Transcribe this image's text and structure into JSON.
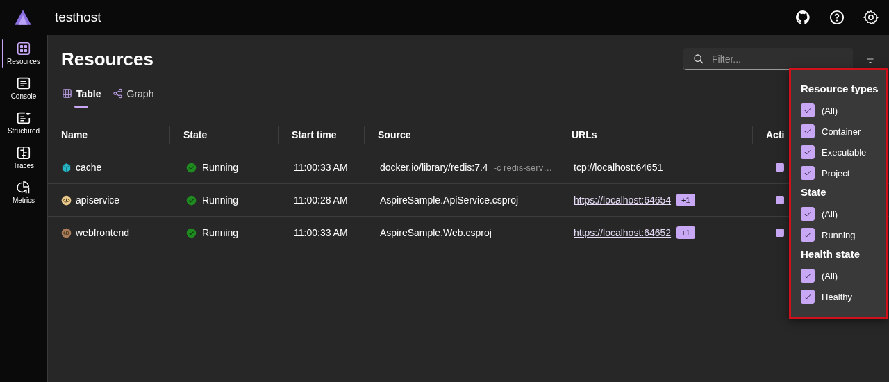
{
  "app": {
    "title": "testhost"
  },
  "header_icons": [
    {
      "kind": "github"
    },
    {
      "kind": "help"
    },
    {
      "kind": "settings"
    }
  ],
  "nav": [
    {
      "label": "Resources",
      "kind": "resources",
      "selected": true
    },
    {
      "label": "Console",
      "kind": "console",
      "selected": false
    },
    {
      "label": "Structured",
      "kind": "structured",
      "selected": false
    },
    {
      "label": "Traces",
      "kind": "traces",
      "selected": false
    },
    {
      "label": "Metrics",
      "kind": "metrics",
      "selected": false
    }
  ],
  "page": {
    "title": "Resources",
    "filter": {
      "placeholder": "Filter..."
    }
  },
  "view_tabs": [
    {
      "label": "Table",
      "kind": "table",
      "selected": true
    },
    {
      "label": "Graph",
      "kind": "graph",
      "selected": false
    }
  ],
  "table": {
    "columns": [
      "Name",
      "State",
      "Start time",
      "Source",
      "URLs",
      "Acti"
    ],
    "rows": [
      {
        "name": "cache",
        "kind": "container",
        "state": "Running",
        "start_time": "11:00:33 AM",
        "source": "docker.io/library/redis:7.4",
        "source_args": "-c redis-serv…",
        "url": "tcp://localhost:64651",
        "url_link": false
      },
      {
        "name": "apiservice",
        "kind": "project",
        "color": "#e8c98a",
        "state": "Running",
        "start_time": "11:00:28 AM",
        "source": "AspireSample.ApiService.csproj",
        "url": "https://localhost:64654",
        "url_link": true,
        "more": "+1"
      },
      {
        "name": "webfrontend",
        "kind": "project",
        "color": "#a87c5a",
        "state": "Running",
        "start_time": "11:00:33 AM",
        "source": "AspireSample.Web.csproj",
        "url": "https://localhost:64652",
        "url_link": true,
        "more": "+1"
      }
    ]
  },
  "filter_popup": {
    "groups": [
      {
        "title": "Resource types",
        "options": [
          {
            "label": "(All)",
            "checked": true
          },
          {
            "label": "Container",
            "checked": true
          },
          {
            "label": "Executable",
            "checked": true
          },
          {
            "label": "Project",
            "checked": true
          }
        ]
      },
      {
        "title": "State",
        "options": [
          {
            "label": "(All)",
            "checked": true
          },
          {
            "label": "Running",
            "checked": true
          }
        ]
      },
      {
        "title": "Health state",
        "options": [
          {
            "label": "(All)",
            "checked": true
          },
          {
            "label": "Healthy",
            "checked": true
          }
        ]
      }
    ]
  }
}
